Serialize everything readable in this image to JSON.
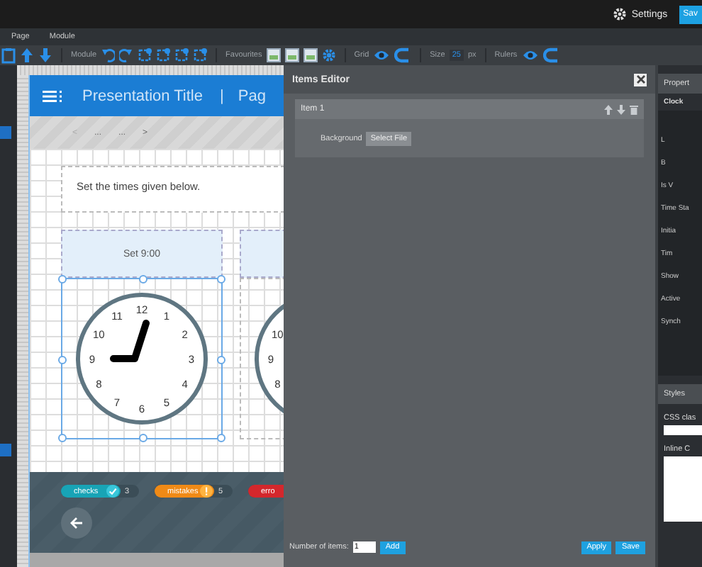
{
  "top_bar": {
    "settings": "Settings",
    "save": "Sav"
  },
  "menu": [
    {
      "label": "Page"
    },
    {
      "label": "Module"
    }
  ],
  "toolbar": {
    "module_label": "Module",
    "favourites_label": "Favourites",
    "grid_label": "Grid",
    "size_label": "Size",
    "size_value": "25",
    "size_unit": "px",
    "rulers_label": "Rulers"
  },
  "slide": {
    "title": "Presentation Title",
    "separator": "|",
    "page": "Pag",
    "nav": [
      "<",
      "...",
      "...",
      ">"
    ],
    "instruction": "Set the times given below.",
    "cards": [
      {
        "heading": "Set 9:00",
        "selected": true,
        "numbers": [
          "12",
          "1",
          "2",
          "3",
          "4",
          "5",
          "6",
          "7",
          "8",
          "9",
          "10",
          "11"
        ]
      },
      {
        "selected": false,
        "numbers": [
          "10",
          "9",
          "8"
        ]
      }
    ],
    "counters": [
      {
        "label": "checks",
        "count": "3",
        "kind": "check",
        "color": "#18a4b6"
      },
      {
        "label": "mistakes",
        "count": "5",
        "kind": "warning",
        "color": "#f08a16"
      },
      {
        "label": "erro",
        "kind": "error",
        "color": "#d4272c"
      }
    ]
  },
  "items_editor": {
    "title": "Items Editor",
    "items": [
      {
        "title": "Item 1",
        "expanded": true,
        "background_label": "Background",
        "select_button": "Select File"
      }
    ],
    "count_label": "Number of items:",
    "count_value": "1",
    "add": "Add",
    "apply": "Apply",
    "save": "Save"
  },
  "properties": {
    "title": "Propert",
    "section": "Clock",
    "fields": [
      "L",
      "B",
      "Is V",
      "Time Sta",
      "Initia",
      "Tim",
      "Show",
      "Active",
      "Synch"
    ],
    "styles": "Styles",
    "css_label": "CSS clas",
    "inline_label": "Inline C"
  }
}
